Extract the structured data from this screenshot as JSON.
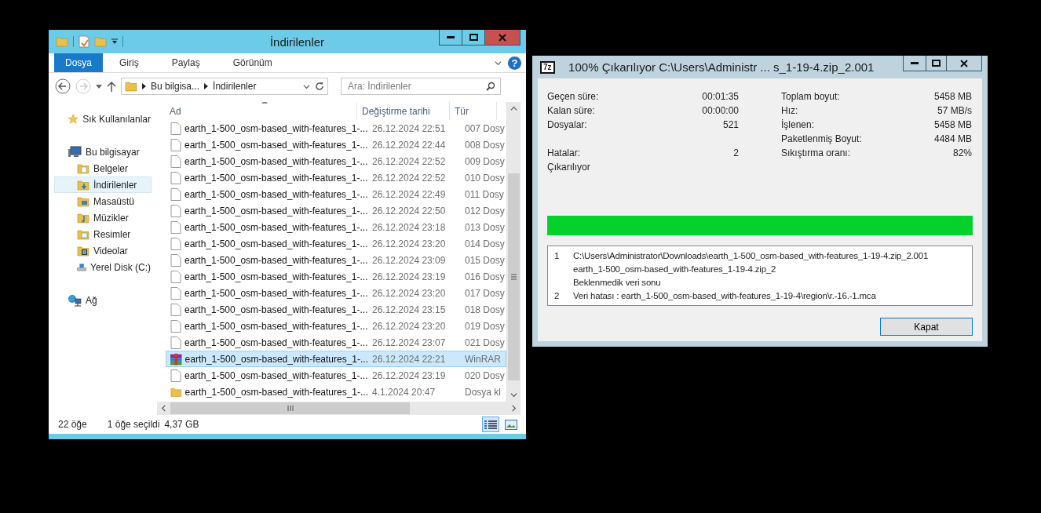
{
  "explorer": {
    "title": "İndirilenler",
    "ribbon_tabs": [
      {
        "label": "Dosya",
        "selected": true
      },
      {
        "label": "Giriş",
        "selected": false
      },
      {
        "label": "Paylaş",
        "selected": false
      },
      {
        "label": "Görünüm",
        "selected": false
      }
    ],
    "help": "?",
    "breadcrumbs": [
      "Bu bilgisa...",
      "İndirilenler"
    ],
    "search": {
      "placeholder": "Ara: İndirilenler"
    },
    "sidebar": [
      {
        "label": "Sık Kullanılanlar",
        "kind": "favorites",
        "selected": false
      },
      {
        "label": "Bu bilgisayar",
        "kind": "computer",
        "selected": false,
        "children": [
          {
            "label": "Belgeler",
            "kind": "documents",
            "selected": false
          },
          {
            "label": "İndirilenler",
            "kind": "downloads",
            "selected": true
          },
          {
            "label": "Masaüstü",
            "kind": "desktop",
            "selected": false
          },
          {
            "label": "Müzikler",
            "kind": "music",
            "selected": false
          },
          {
            "label": "Resimler",
            "kind": "pictures",
            "selected": false
          },
          {
            "label": "Videolar",
            "kind": "videos",
            "selected": false
          },
          {
            "label": "Yerel Disk (C:)",
            "kind": "disk",
            "selected": false
          }
        ]
      },
      {
        "label": "Ağ",
        "kind": "network",
        "selected": false
      }
    ],
    "columns": [
      "Ad",
      "Değiştirme tarihi",
      "Tür"
    ],
    "files": [
      {
        "name": "earth_1-500_osm-based_with-features_1-...",
        "date": "26.12.2024 22:51",
        "type": "007 Dosy",
        "kind": "file",
        "selected": false
      },
      {
        "name": "earth_1-500_osm-based_with-features_1-...",
        "date": "26.12.2024 22:44",
        "type": "008 Dosy",
        "kind": "file",
        "selected": false
      },
      {
        "name": "earth_1-500_osm-based_with-features_1-...",
        "date": "26.12.2024 22:52",
        "type": "009 Dosy",
        "kind": "file",
        "selected": false
      },
      {
        "name": "earth_1-500_osm-based_with-features_1-...",
        "date": "26.12.2024 22:52",
        "type": "010 Dosy",
        "kind": "file",
        "selected": false
      },
      {
        "name": "earth_1-500_osm-based_with-features_1-...",
        "date": "26.12.2024 22:49",
        "type": "011 Dosy",
        "kind": "file",
        "selected": false
      },
      {
        "name": "earth_1-500_osm-based_with-features_1-...",
        "date": "26.12.2024 22:50",
        "type": "012 Dosy",
        "kind": "file",
        "selected": false
      },
      {
        "name": "earth_1-500_osm-based_with-features_1-...",
        "date": "26.12.2024 23:18",
        "type": "013 Dosy",
        "kind": "file",
        "selected": false
      },
      {
        "name": "earth_1-500_osm-based_with-features_1-...",
        "date": "26.12.2024 23:20",
        "type": "014 Dosy",
        "kind": "file",
        "selected": false
      },
      {
        "name": "earth_1-500_osm-based_with-features_1-...",
        "date": "26.12.2024 23:09",
        "type": "015 Dosy",
        "kind": "file",
        "selected": false
      },
      {
        "name": "earth_1-500_osm-based_with-features_1-...",
        "date": "26.12.2024 23:19",
        "type": "016 Dosy",
        "kind": "file",
        "selected": false
      },
      {
        "name": "earth_1-500_osm-based_with-features_1-...",
        "date": "26.12.2024 23:20",
        "type": "017 Dosy",
        "kind": "file",
        "selected": false
      },
      {
        "name": "earth_1-500_osm-based_with-features_1-...",
        "date": "26.12.2024 23:15",
        "type": "018 Dosy",
        "kind": "file",
        "selected": false
      },
      {
        "name": "earth_1-500_osm-based_with-features_1-...",
        "date": "26.12.2024 23:20",
        "type": "019 Dosy",
        "kind": "file",
        "selected": false
      },
      {
        "name": "earth_1-500_osm-based_with-features_1-...",
        "date": "26.12.2024 23:07",
        "type": "021 Dosy",
        "kind": "file",
        "selected": false
      },
      {
        "name": "earth_1-500_osm-based_with-features_1-...",
        "date": "26.12.2024 22:21",
        "type": "WinRAR",
        "kind": "archive",
        "selected": true
      },
      {
        "name": "earth_1-500_osm-based_with-features_1-...",
        "date": "26.12.2024 23:19",
        "type": "020 Dosy",
        "kind": "file",
        "selected": false
      },
      {
        "name": "earth_1-500_osm-based_with-features_1-...",
        "date": "4.1.2024 20:47",
        "type": "Dosya kl",
        "kind": "folder",
        "selected": false
      }
    ],
    "status": {
      "count": "22 öğe",
      "selection": "1 öğe seçildi",
      "size": "4,37 GB"
    },
    "views": [
      {
        "kind": "details",
        "selected": true
      },
      {
        "kind": "tiles",
        "selected": false
      }
    ]
  },
  "extract": {
    "logo": "7z",
    "title": "100% Çıkarılıyor C:\\Users\\Administr ... s_1-19-4.zip_2.001",
    "left_stats": [
      {
        "label": "Geçen süre:",
        "value": "00:01:35"
      },
      {
        "label": "Kalan süre:",
        "value": "00:00:00"
      },
      {
        "label": "Dosyalar:",
        "value": "521"
      }
    ],
    "errors": {
      "label": "Hatalar:",
      "value": "2"
    },
    "right_stats": [
      {
        "label": "Toplam boyut:",
        "value": "5458 MB"
      },
      {
        "label": "Hız:",
        "value": "57 MB/s"
      },
      {
        "label": "İşlenen:",
        "value": "5458 MB"
      },
      {
        "label": "Paketlenmiş Boyut:",
        "value": "4484 MB"
      },
      {
        "label": "Sıkıştırma oranı:",
        "value": "82%"
      }
    ],
    "status": "Çıkarılıyor",
    "progress": {
      "level": 1
    },
    "messages": [
      {
        "number": "1",
        "lines": [
          "C:\\Users\\Administrator\\Downloads\\earth_1-500_osm-based_with-features_1-19-4.zip_2.001",
          "earth_1-500_osm-based_with-features_1-19-4.zip_2",
          "Beklenmedik veri sonu"
        ]
      },
      {
        "number": "2",
        "lines": [
          "Veri hatası : earth_1-500_osm-based_with-features_1-19-4\\region\\r.-16.-1.mca"
        ]
      }
    ],
    "button": "Kapat"
  }
}
